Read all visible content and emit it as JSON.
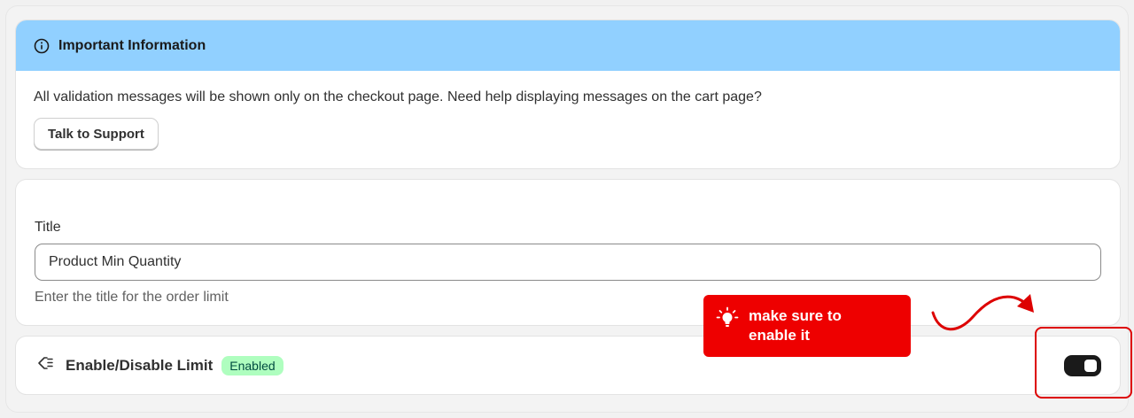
{
  "banner": {
    "title": "Important Information",
    "message": "All validation messages will be shown only on the checkout page. Need help displaying messages on the cart page?",
    "button_label": "Talk to Support"
  },
  "title_field": {
    "label": "Title",
    "value": "Product Min Quantity",
    "help_text": "Enter the title for the order limit"
  },
  "enable_section": {
    "label": "Enable/Disable Limit",
    "status_badge": "Enabled",
    "toggle_on": true
  },
  "annotation": {
    "tooltip_text": "make sure to enable it",
    "color": "#ee0000"
  },
  "icons": {
    "banner": "info-icon",
    "enable": "price-tag-icon",
    "tooltip": "lightbulb-icon"
  },
  "colors": {
    "banner_bg": "#91d0ff",
    "badge_bg": "#affebf",
    "toggle_bg": "#1a1a1a"
  }
}
